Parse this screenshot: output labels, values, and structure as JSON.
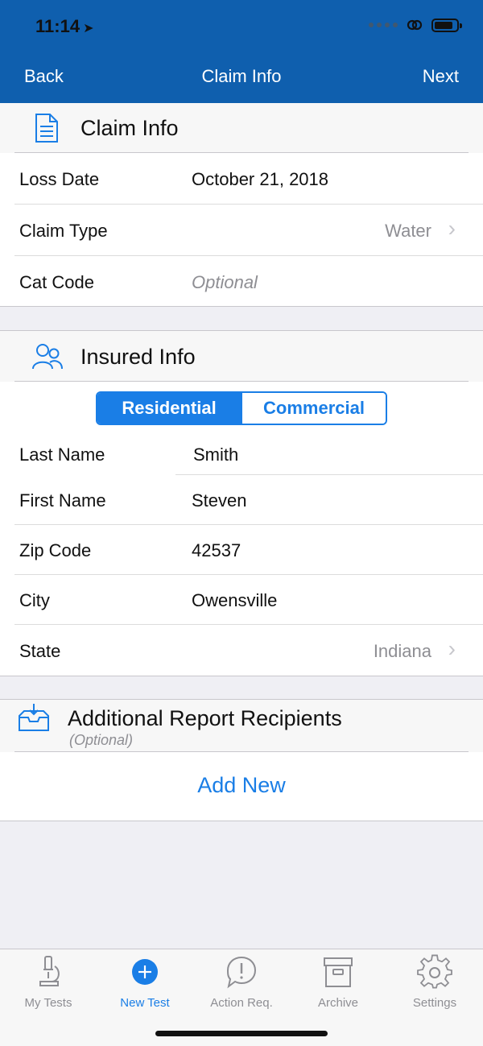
{
  "status_bar": {
    "time": "11:14",
    "location_glyph": "➤"
  },
  "nav": {
    "back": "Back",
    "title": "Claim Info",
    "next": "Next"
  },
  "claim_section": {
    "title": "Claim Info",
    "icon": "document-icon",
    "rows": [
      {
        "label": "Loss Date",
        "value": "October 21, 2018"
      },
      {
        "label": "Claim Type",
        "value": "Water"
      },
      {
        "label": "Cat Code",
        "placeholder": "Optional"
      }
    ]
  },
  "insured_section": {
    "title": "Insured Info",
    "icon": "people-icon",
    "segment": {
      "selected": "Residential",
      "other": "Commercial"
    },
    "rows": [
      {
        "label": "Last Name",
        "value": "Smith"
      },
      {
        "label": "First Name",
        "value": "Steven"
      },
      {
        "label": "Zip Code",
        "value": "42537"
      },
      {
        "label": "City",
        "value": "Owensville"
      },
      {
        "label": "State",
        "value": "Indiana"
      }
    ]
  },
  "recipients_section": {
    "title": "Additional Report Recipients",
    "subtitle": "(Optional)",
    "icon": "inbox-icon",
    "add_new": "Add New"
  },
  "tabbar": [
    {
      "label": "My Tests",
      "icon": "microscope-icon"
    },
    {
      "label": "New Test",
      "icon": "plus-circle-icon",
      "active": true
    },
    {
      "label": "Action Req.",
      "icon": "alert-bubble-icon"
    },
    {
      "label": "Archive",
      "icon": "archive-box-icon"
    },
    {
      "label": "Settings",
      "icon": "gear-icon"
    }
  ],
  "colors": {
    "nav_bg": "#0f5fae",
    "accent": "#1a7ee6",
    "background": "#efeff4"
  }
}
